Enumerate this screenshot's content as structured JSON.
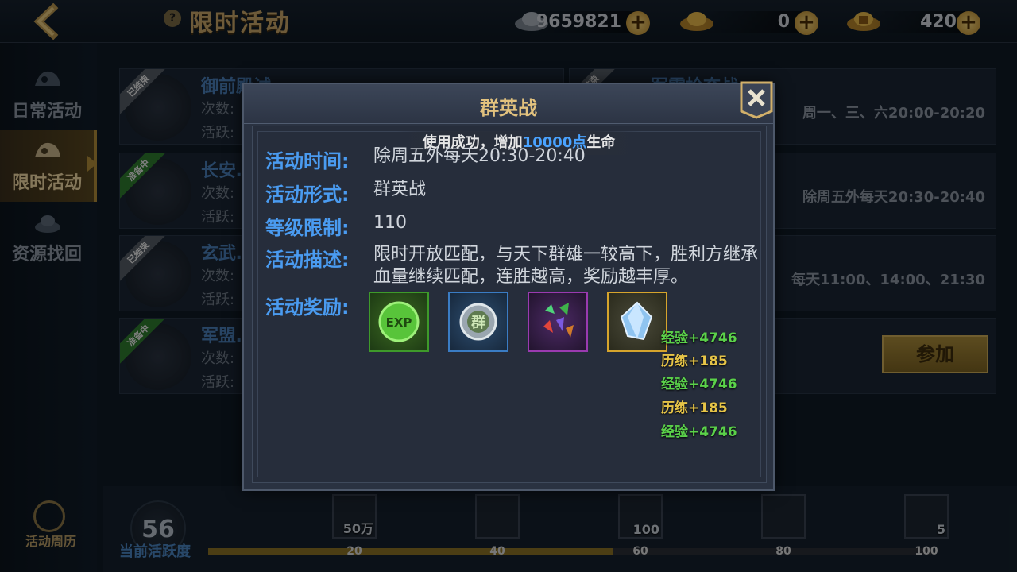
{
  "header": {
    "title": "限时活动",
    "help_glyph": "?",
    "currencies": [
      {
        "name": "silver",
        "value": "9659821"
      },
      {
        "name": "gold",
        "value": "0"
      },
      {
        "name": "bound-gold",
        "value": "420"
      }
    ],
    "plus_glyph": "+"
  },
  "sidebar": {
    "items": [
      {
        "label": "日常活动",
        "icon": "daily-icon"
      },
      {
        "label": "限时活动",
        "icon": "limited-icon",
        "active": true
      },
      {
        "label": "资源找回",
        "icon": "recover-icon"
      }
    ]
  },
  "events": [
    {
      "name": "御前殿试",
      "ribbon": "已结束",
      "count_label": "次数:",
      "active_label": "活跃:"
    },
    {
      "name": "长安…",
      "ribbon": "准备中",
      "count_label": "次数:",
      "active_label": "活跃:"
    },
    {
      "name": "玄武…",
      "ribbon": "已结束",
      "count_label": "次数:",
      "active_label": "活跃:"
    },
    {
      "name": "军盟…",
      "ribbon": "准备中",
      "count_label": "次数:",
      "active_label": "活跃:"
    }
  ],
  "right_events": [
    {
      "name": "军需抢夺战",
      "time": "周一、三、六20:00-20:20"
    },
    {
      "time": "除周五外每天20:30-20:40"
    },
    {
      "time": "每天11:00、14:00、21:30"
    }
  ],
  "join_button": "参加",
  "activity": {
    "calendar_label": "活动周历",
    "current_value": "56",
    "current_label": "当前活跃度",
    "progress_percent": 56,
    "milestones": [
      {
        "mark": "20",
        "count": "50万"
      },
      {
        "mark": "40",
        "count": ""
      },
      {
        "mark": "60",
        "count": "100"
      },
      {
        "mark": "80",
        "count": ""
      },
      {
        "mark": "100",
        "count": "5"
      }
    ]
  },
  "modal": {
    "title": "群英战",
    "close_glyph": "✕",
    "toast": {
      "prefix": "使用成功，增加",
      "amount": "10000点",
      "suffix": "生命"
    },
    "rows": [
      {
        "label": "活动时间:",
        "value": "除周五外每天20:30-20:40"
      },
      {
        "label": "活动形式:",
        "value": "群英战"
      },
      {
        "label": "等级限制:",
        "value": "110"
      },
      {
        "label": "活动描述:",
        "value": "限时开放匹配，与天下群雄一较高下，胜利方继承血量继续匹配，连胜越高，奖励越丰厚。"
      },
      {
        "label": "活动奖励:",
        "value": ""
      }
    ],
    "rewards": [
      {
        "name": "exp-orb-icon",
        "text": "EXP",
        "rarity": "green"
      },
      {
        "name": "group-token-icon",
        "text": "群",
        "rarity": "blue"
      },
      {
        "name": "gem-pack-icon",
        "text": "",
        "rarity": "purple"
      },
      {
        "name": "crystal-icon",
        "text": "",
        "rarity": "gold"
      }
    ]
  },
  "float_texts": [
    {
      "text": "经验+4746",
      "kind": "exp"
    },
    {
      "text": "历练+185",
      "kind": "lilian"
    },
    {
      "text": "经验+4746",
      "kind": "exp"
    },
    {
      "text": "历练+185",
      "kind": "lilian"
    },
    {
      "text": "经验+4746",
      "kind": "exp"
    }
  ]
}
